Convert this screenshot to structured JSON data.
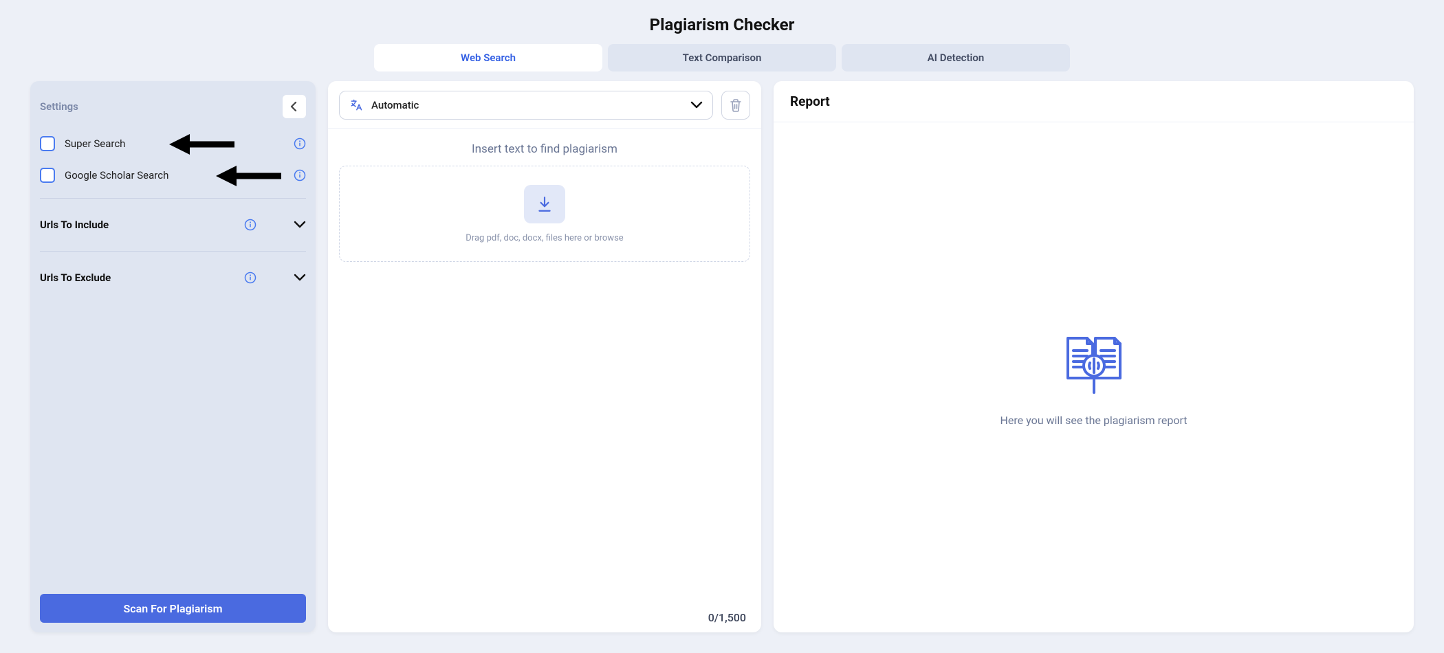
{
  "page": {
    "title": "Plagiarism Checker"
  },
  "tabs": [
    {
      "label": "Web Search",
      "active": true
    },
    {
      "label": "Text Comparison",
      "active": false
    },
    {
      "label": "AI Detection",
      "active": false
    }
  ],
  "sidebar": {
    "title": "Settings",
    "options": [
      {
        "label": "Super Search",
        "checked": false
      },
      {
        "label": "Google Scholar Search",
        "checked": false
      }
    ],
    "accordions": [
      {
        "label": "Urls To Include"
      },
      {
        "label": "Urls To Exclude"
      }
    ],
    "scan_label": "Scan For Plagiarism"
  },
  "input": {
    "language_select": "Automatic",
    "hint": "Insert text to find plagiarism",
    "drop_text": "Drag pdf, doc, docx, files here or browse",
    "counter": "0/1,500"
  },
  "report": {
    "title": "Report",
    "placeholder": "Here you will see the plagiarism report"
  }
}
